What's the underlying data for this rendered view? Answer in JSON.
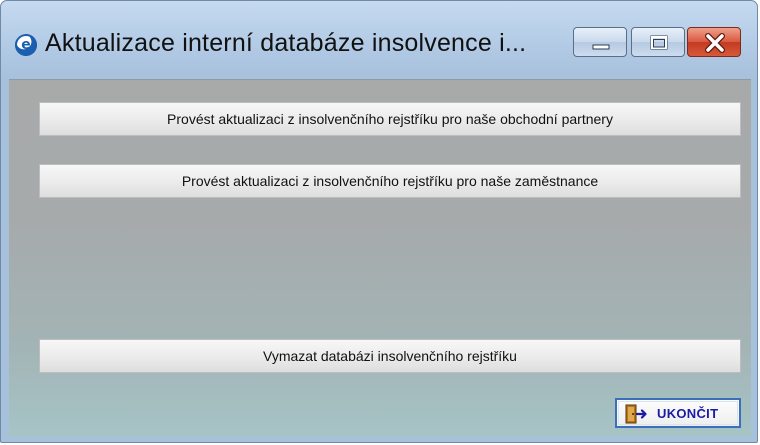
{
  "window": {
    "title": "Aktualizace interní databáze insolvence  i...",
    "icon": "app-e-icon",
    "icon_glyph": "e",
    "controls": {
      "minimize_icon": "minimize-icon",
      "maximize_icon": "maximize-icon",
      "close_icon": "close-icon"
    }
  },
  "actions": {
    "update_partners_label": "Provést aktualizaci z insolvenčního rejstříku pro naše obchodní partnery",
    "update_employees_label": "Provést aktualizaci z insolvenčního rejstříku pro naše zaměstnance",
    "delete_database_label": "Vymazat databázi insolvenčního rejstříku"
  },
  "footer": {
    "exit_label": "UKONČIT",
    "exit_icon": "exit-door-icon"
  },
  "colors": {
    "close_button": "#d9583f",
    "exit_text": "#1a1aa8",
    "exit_border": "#3d6fb8"
  }
}
